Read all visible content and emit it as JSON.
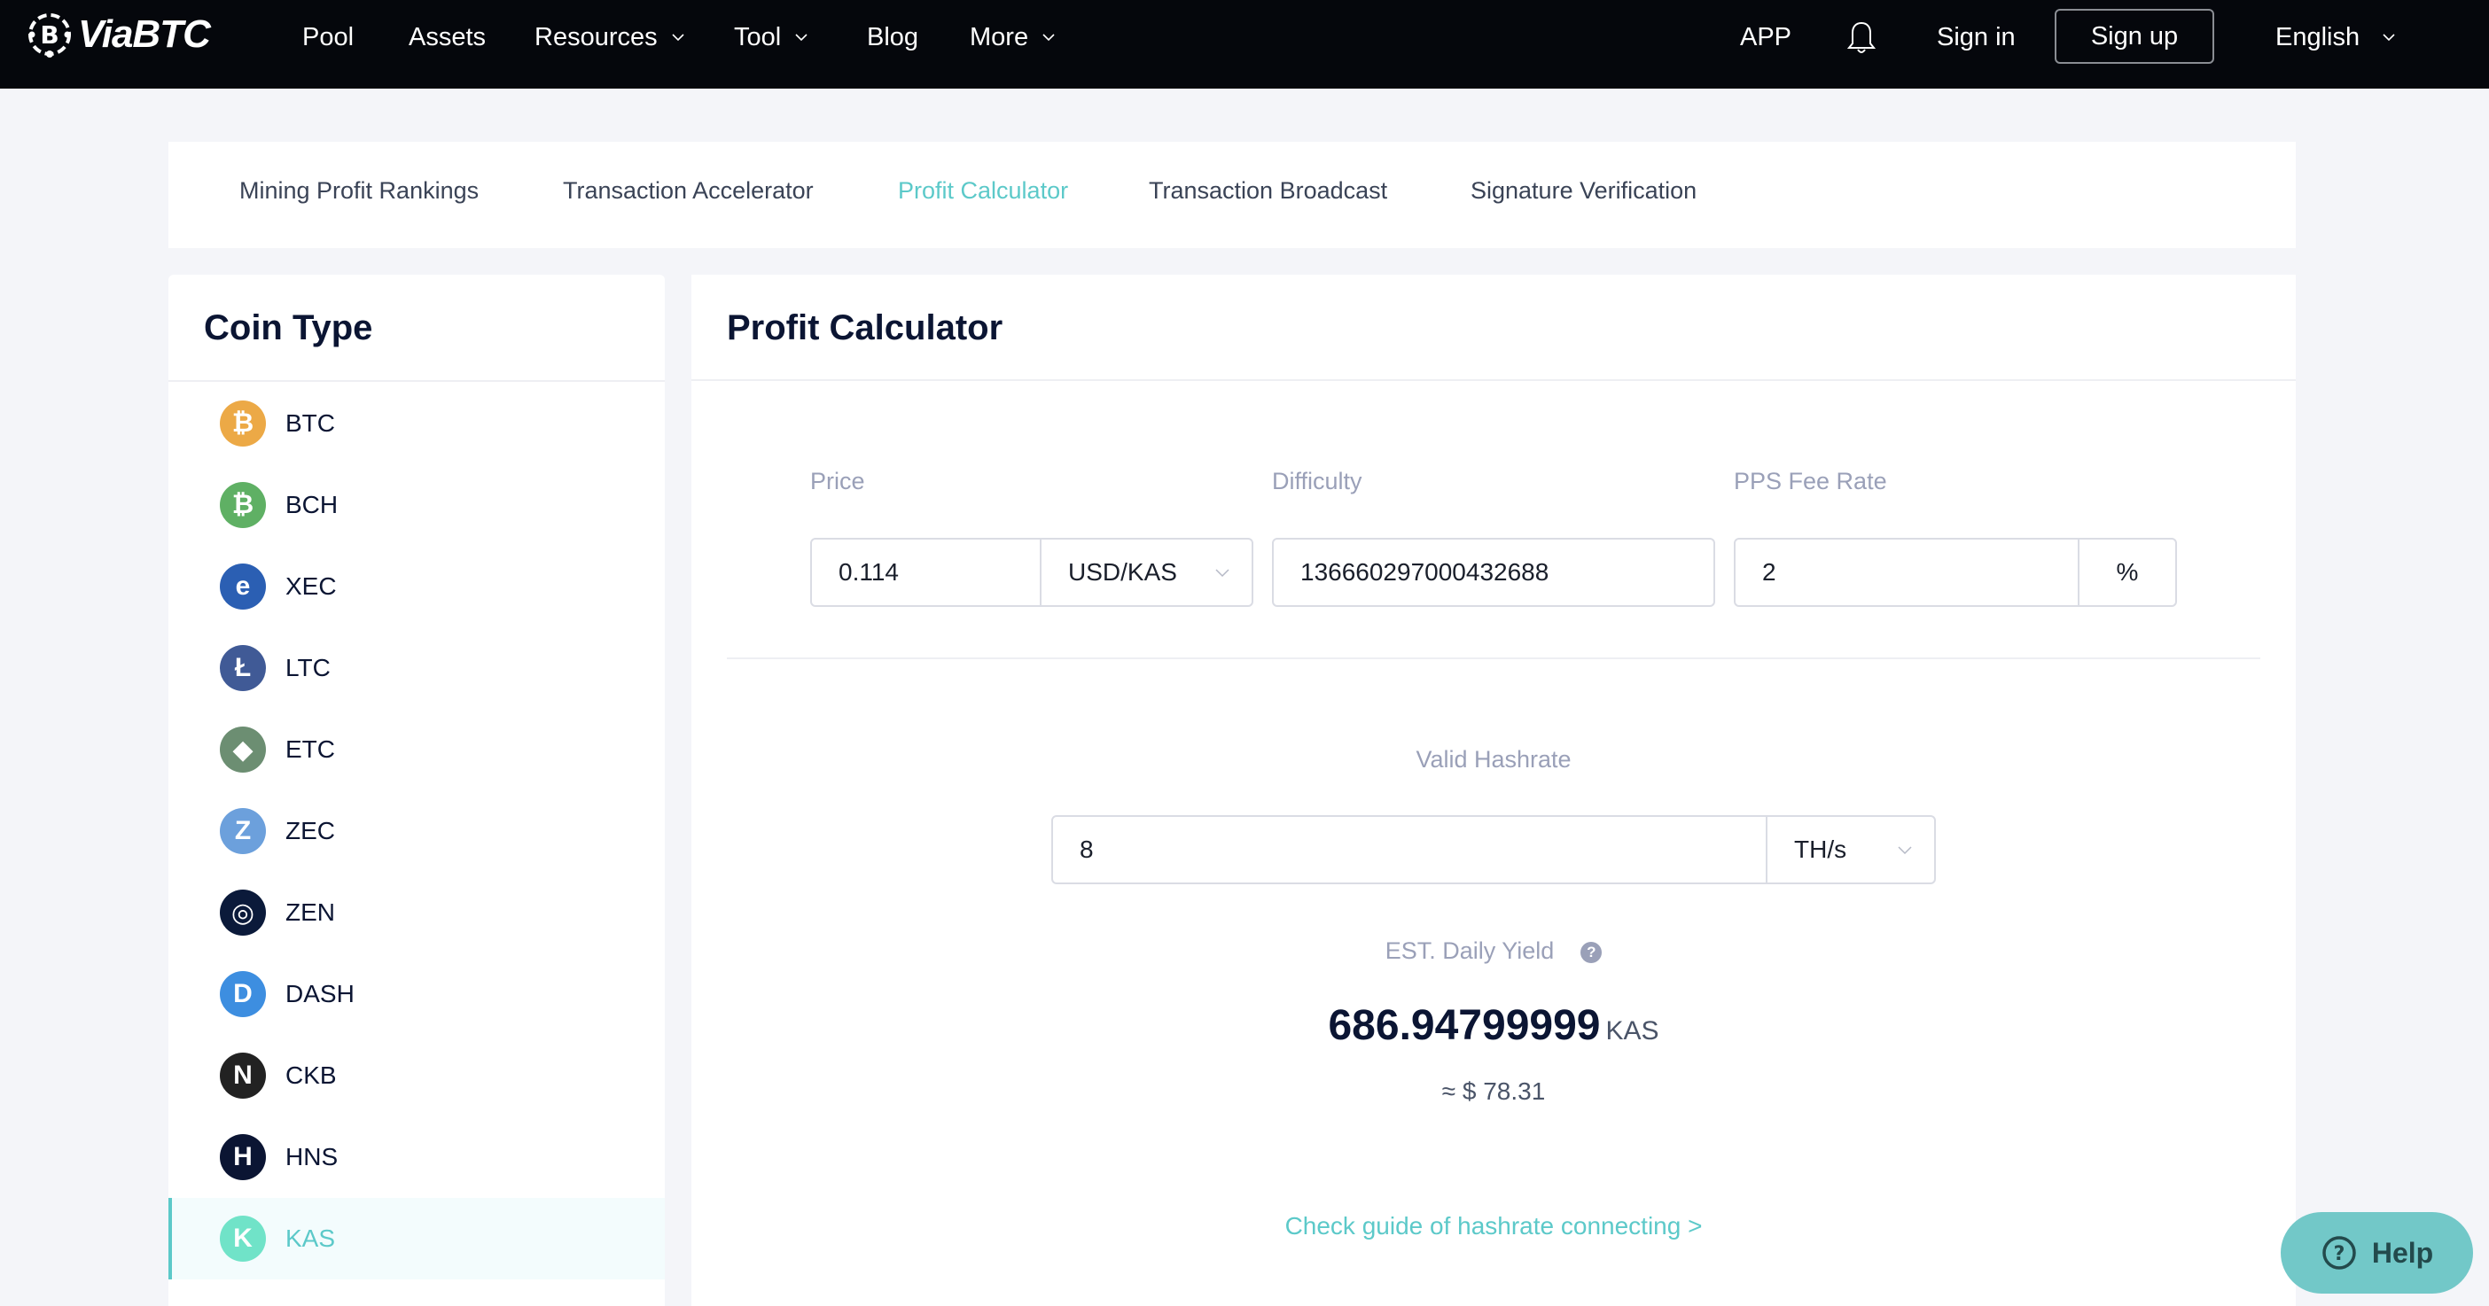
{
  "navbar": {
    "logo_text": "ViaBTC",
    "items": [
      {
        "label": "Pool",
        "has_dropdown": false
      },
      {
        "label": "Assets",
        "has_dropdown": false
      },
      {
        "label": "Resources",
        "has_dropdown": true
      },
      {
        "label": "Tool",
        "has_dropdown": true
      },
      {
        "label": "Blog",
        "has_dropdown": false
      },
      {
        "label": "More",
        "has_dropdown": true
      }
    ],
    "app_label": "APP",
    "sign_in_label": "Sign in",
    "sign_up_label": "Sign up",
    "language_label": "English"
  },
  "tabs": [
    {
      "label": "Mining Profit Rankings",
      "active": false
    },
    {
      "label": "Transaction Accelerator",
      "active": false
    },
    {
      "label": "Profit Calculator",
      "active": true
    },
    {
      "label": "Transaction Broadcast",
      "active": false
    },
    {
      "label": "Signature Verification",
      "active": false
    }
  ],
  "sidebar": {
    "title": "Coin Type",
    "coins": [
      {
        "symbol": "BTC",
        "icon": "bitcoin-icon",
        "color": "#eca946",
        "glyph": "₿",
        "active": false
      },
      {
        "symbol": "BCH",
        "icon": "bitcoin-cash-icon",
        "color": "#5fb064",
        "glyph": "₿",
        "active": false
      },
      {
        "symbol": "XEC",
        "icon": "ecash-icon",
        "color": "#2b5fb3",
        "glyph": "e",
        "active": false
      },
      {
        "symbol": "LTC",
        "icon": "litecoin-icon",
        "color": "#405a96",
        "glyph": "Ł",
        "active": false
      },
      {
        "symbol": "ETC",
        "icon": "ethereum-classic-icon",
        "color": "#6c8e72",
        "glyph": "◆",
        "active": false
      },
      {
        "symbol": "ZEC",
        "icon": "zcash-icon",
        "color": "#6ca0dc",
        "glyph": "Z",
        "active": false
      },
      {
        "symbol": "ZEN",
        "icon": "horizen-icon",
        "color": "#0b1a3a",
        "glyph": "◎",
        "active": false
      },
      {
        "symbol": "DASH",
        "icon": "dash-icon",
        "color": "#3d8ee0",
        "glyph": "D",
        "active": false
      },
      {
        "symbol": "CKB",
        "icon": "nervos-icon",
        "color": "#222222",
        "glyph": "N",
        "active": false
      },
      {
        "symbol": "HNS",
        "icon": "handshake-icon",
        "color": "#0b1533",
        "glyph": "H",
        "active": false
      },
      {
        "symbol": "KAS",
        "icon": "kaspa-icon",
        "color": "#70e3c8",
        "glyph": "K",
        "active": true
      }
    ]
  },
  "calculator": {
    "title": "Profit Calculator",
    "price": {
      "label": "Price",
      "value": "0.114",
      "unit": "USD/KAS"
    },
    "difficulty": {
      "label": "Difficulty",
      "value": "136660297000432688"
    },
    "fee": {
      "label": "PPS Fee Rate",
      "value": "2",
      "unit": "%"
    },
    "hashrate": {
      "label": "Valid Hashrate",
      "value": "8",
      "unit": "TH/s"
    },
    "yield": {
      "label": "EST. Daily Yield",
      "value": "686.94799999",
      "unit": "KAS",
      "usd": "≈ $ 78.31"
    },
    "guide_link": "Check guide of hashrate connecting >"
  },
  "help": {
    "label": "Help"
  },
  "colors": {
    "accent": "#5cc9c9",
    "navbar_bg": "#05070c",
    "page_bg": "#f4f5f9",
    "help_bg": "#72c8c8"
  }
}
